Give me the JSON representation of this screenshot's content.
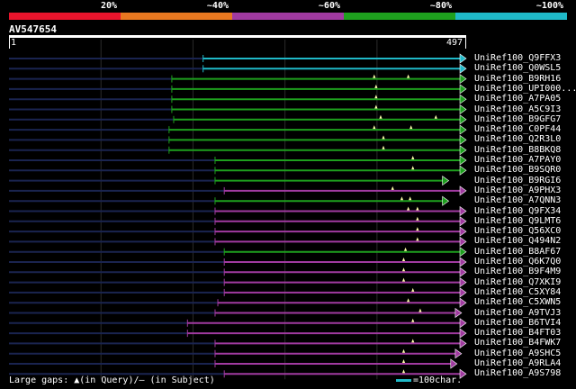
{
  "legend": {
    "labels": [
      "20%",
      "~40%",
      "~60%",
      "~80%",
      "~100%"
    ],
    "colors": [
      "#e8142c",
      "#e87820",
      "#a03aa0",
      "#1ea01e",
      "#1fb9c8"
    ]
  },
  "query": {
    "id": "AV547654",
    "start": "1",
    "end": "497",
    "length": 497
  },
  "hits": [
    {
      "name": "UniRef100_Q9FFX3",
      "color": "cyan",
      "start": 212,
      "end": 497,
      "marks": []
    },
    {
      "name": "UniRef100_Q0WSL5",
      "color": "cyan",
      "start": 212,
      "end": 497,
      "marks": []
    },
    {
      "name": "UniRef100_B9RH16",
      "color": "green",
      "start": 178,
      "end": 497,
      "marks": [
        398,
        435
      ]
    },
    {
      "name": "UniRef100_UPI000...",
      "color": "green",
      "start": 178,
      "end": 497,
      "marks": [
        400
      ]
    },
    {
      "name": "UniRef100_A7PA05",
      "color": "green",
      "start": 178,
      "end": 497,
      "marks": [
        400
      ]
    },
    {
      "name": "UniRef100_A5C9I3",
      "color": "green",
      "start": 178,
      "end": 497,
      "marks": [
        400
      ]
    },
    {
      "name": "UniRef100_B9GFG7",
      "color": "green",
      "start": 180,
      "end": 497,
      "marks": [
        405,
        465
      ]
    },
    {
      "name": "UniRef100_C0PF44",
      "color": "green",
      "start": 175,
      "end": 497,
      "marks": [
        398,
        438
      ]
    },
    {
      "name": "UniRef100_Q2R3L0",
      "color": "green",
      "start": 175,
      "end": 497,
      "marks": [
        408
      ]
    },
    {
      "name": "UniRef100_B8BKQ8",
      "color": "green",
      "start": 175,
      "end": 497,
      "marks": [
        408
      ]
    },
    {
      "name": "UniRef100_A7PAY0",
      "color": "green",
      "start": 225,
      "end": 497,
      "marks": [
        440
      ]
    },
    {
      "name": "UniRef100_B9SQR0",
      "color": "green",
      "start": 225,
      "end": 497,
      "marks": [
        440
      ]
    },
    {
      "name": "UniRef100_B9RGI6",
      "color": "green",
      "start": 225,
      "end": 478,
      "marks": []
    },
    {
      "name": "UniRef100_A9PHX3",
      "color": "purple",
      "start": 235,
      "end": 497,
      "marks": [
        418
      ]
    },
    {
      "name": "UniRef100_A7QNN3",
      "color": "green",
      "start": 225,
      "end": 478,
      "marks": [
        428,
        437
      ]
    },
    {
      "name": "UniRef100_Q9FX34",
      "color": "purple",
      "start": 225,
      "end": 497,
      "marks": [
        435,
        445
      ]
    },
    {
      "name": "UniRef100_Q9LMT6",
      "color": "purple",
      "start": 225,
      "end": 497,
      "marks": [
        445
      ]
    },
    {
      "name": "UniRef100_Q56XC0",
      "color": "purple",
      "start": 225,
      "end": 497,
      "marks": [
        445
      ]
    },
    {
      "name": "UniRef100_Q494N2",
      "color": "purple",
      "start": 225,
      "end": 497,
      "marks": [
        445
      ]
    },
    {
      "name": "UniRef100_B8AF67",
      "color": "green",
      "start": 235,
      "end": 497,
      "marks": [
        432
      ]
    },
    {
      "name": "UniRef100_Q6K7Q0",
      "color": "purple",
      "start": 235,
      "end": 497,
      "marks": [
        430
      ]
    },
    {
      "name": "UniRef100_B9F4M9",
      "color": "purple",
      "start": 235,
      "end": 497,
      "marks": [
        430
      ]
    },
    {
      "name": "UniRef100_Q7XKI9",
      "color": "purple",
      "start": 235,
      "end": 497,
      "marks": [
        430
      ]
    },
    {
      "name": "UniRef100_C5XY84",
      "color": "purple",
      "start": 235,
      "end": 497,
      "marks": [
        440
      ]
    },
    {
      "name": "UniRef100_C5XWN5",
      "color": "purple",
      "start": 228,
      "end": 497,
      "marks": [
        435
      ]
    },
    {
      "name": "UniRef100_A9TVJ3",
      "color": "purple",
      "start": 225,
      "end": 492,
      "marks": [
        448
      ]
    },
    {
      "name": "UniRef100_B6TVI4",
      "color": "purple",
      "start": 195,
      "end": 497,
      "marks": [
        440
      ]
    },
    {
      "name": "UniRef100_B4FT03",
      "color": "purple",
      "start": 195,
      "end": 497,
      "marks": []
    },
    {
      "name": "UniRef100_B4FWK7",
      "color": "purple",
      "start": 225,
      "end": 497,
      "marks": [
        440
      ]
    },
    {
      "name": "UniRef100_A9SHC5",
      "color": "purple",
      "start": 225,
      "end": 492,
      "marks": [
        430
      ]
    },
    {
      "name": "UniRef100_A9RLA4",
      "color": "purple",
      "start": 225,
      "end": 487,
      "marks": [
        430
      ]
    },
    {
      "name": "UniRef100_A9S798",
      "color": "purple",
      "start": 235,
      "end": 497,
      "marks": [
        430
      ]
    }
  ],
  "footer": {
    "legend_text": "Large gaps: ▲(in Query)/– (in Subject)",
    "scale_text": "=100char."
  }
}
